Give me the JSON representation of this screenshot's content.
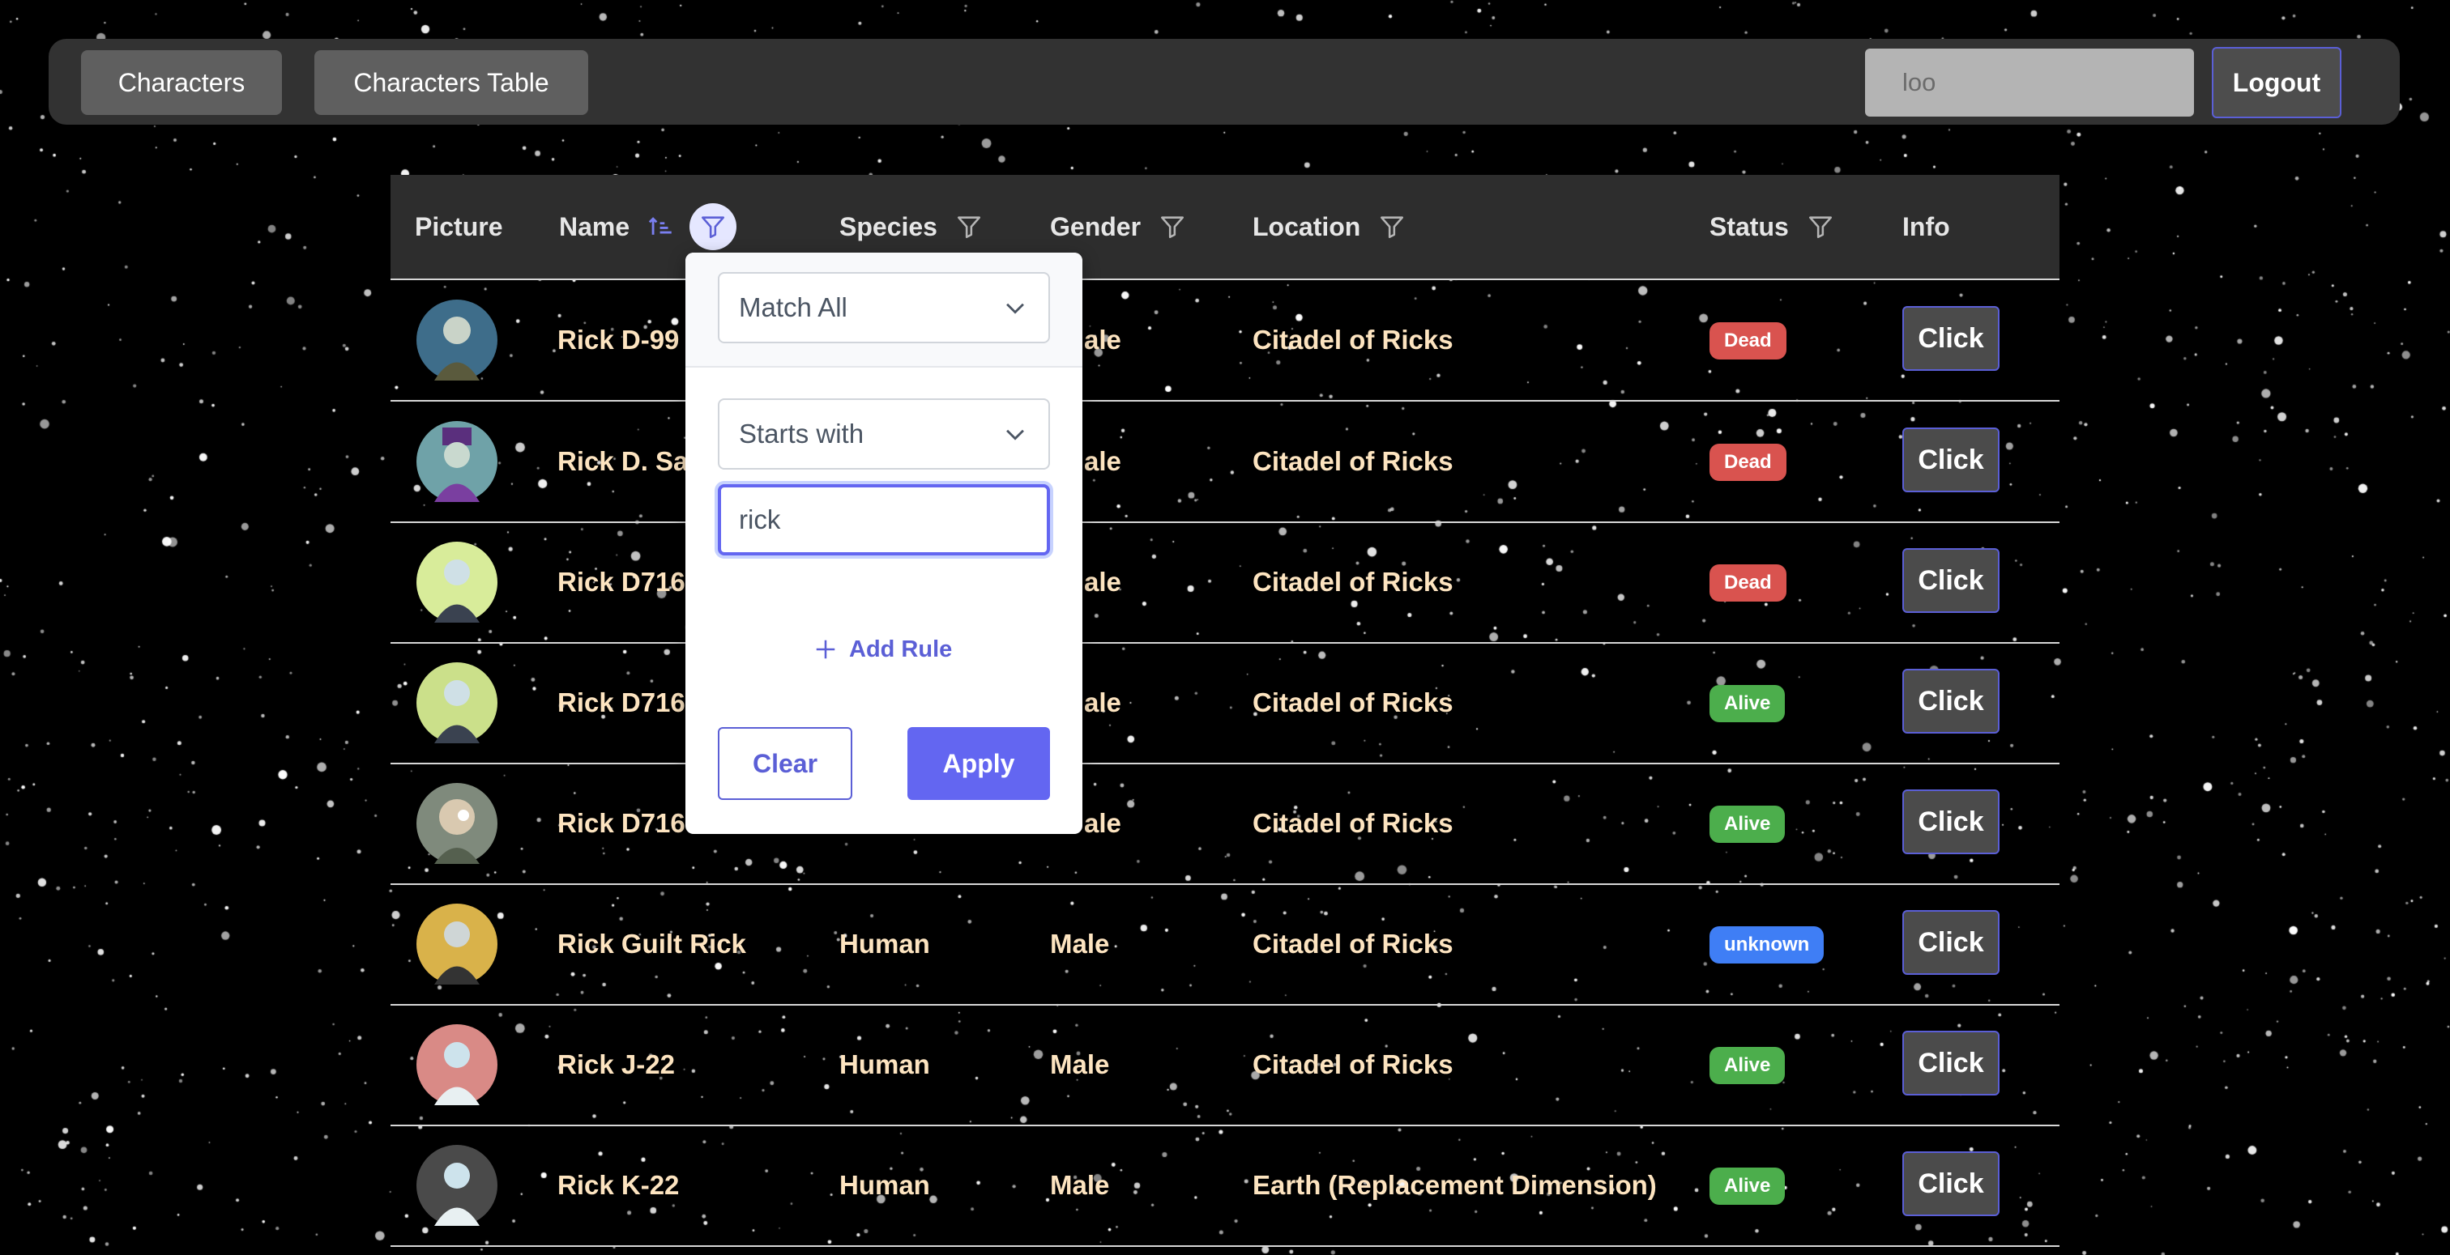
{
  "topbar": {
    "nav": [
      "Characters",
      "Characters Table"
    ],
    "search_value": "loo",
    "logout_label": "Logout"
  },
  "table": {
    "headers": [
      "Picture",
      "Name",
      "Species",
      "Gender",
      "Location",
      "Status",
      "Info"
    ],
    "rows": [
      {
        "name": "Rick D-99",
        "species": "",
        "gender": "ale",
        "location": "Citadel of Ricks",
        "status": "Dead",
        "info": "Click"
      },
      {
        "name": "Rick D. Sa",
        "species": "",
        "gender": "ale",
        "location": "Citadel of Ricks",
        "status": "Dead",
        "info": "Click"
      },
      {
        "name": "Rick D716",
        "species": "",
        "gender": "ale",
        "location": "Citadel of Ricks",
        "status": "Dead",
        "info": "Click"
      },
      {
        "name": "Rick D716",
        "species": "",
        "gender": "ale",
        "location": "Citadel of Ricks",
        "status": "Alive",
        "info": "Click"
      },
      {
        "name": "Rick D716",
        "species": "",
        "gender": "ale",
        "location": "Citadel of Ricks",
        "status": "Alive",
        "info": "Click"
      },
      {
        "name": "Rick Guilt Rick",
        "species": "Human",
        "gender": "Male",
        "location": "Citadel of Ricks",
        "status": "unknown",
        "info": "Click"
      },
      {
        "name": "Rick J-22",
        "species": "Human",
        "gender": "Male",
        "location": "Citadel of Ricks",
        "status": "Alive",
        "info": "Click"
      },
      {
        "name": "Rick K-22",
        "species": "Human",
        "gender": "Male",
        "location": "Earth (Replacement Dimension)",
        "status": "Alive",
        "info": "Click"
      }
    ]
  },
  "filter_popup": {
    "operator": "Match All",
    "match_mode": "Starts with",
    "value": "rick",
    "add_rule_label": "Add Rule",
    "clear_label": "Clear",
    "apply_label": "Apply"
  },
  "colors": {
    "dead": "#d9534f",
    "alive": "#4cae4c",
    "unknown": "#3f7ef5",
    "accent": "#6366f1",
    "row_text": "#fde4c0"
  }
}
